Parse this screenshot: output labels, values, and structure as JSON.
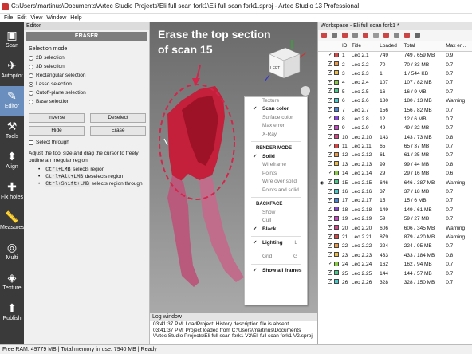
{
  "window": {
    "title": "C:\\Users\\martinus\\Documents\\Artec Studio Projects\\Eli full scan fork1\\Eli full scan fork1.sproj - Artec Studio 13 Professional"
  },
  "menu": [
    "File",
    "Edit",
    "View",
    "Window",
    "Help"
  ],
  "tools": [
    {
      "label": "Scan",
      "icon": "scan-icon"
    },
    {
      "label": "Autopilot",
      "icon": "autopilot-icon"
    },
    {
      "label": "Editor",
      "icon": "editor-icon"
    },
    {
      "label": "Tools",
      "icon": "tools-icon"
    },
    {
      "label": "Align",
      "icon": "align-icon"
    },
    {
      "label": "Fix holes",
      "icon": "fix-holes-icon"
    },
    {
      "label": "Measures",
      "icon": "measures-icon"
    },
    {
      "label": "Multi",
      "icon": "multi-icon"
    },
    {
      "label": "Texture",
      "icon": "texture-icon"
    },
    {
      "label": "Publish",
      "icon": "publish-icon"
    }
  ],
  "editor": {
    "header": "Editor",
    "tool_title": "ERASER",
    "selection_mode_label": "Selection mode",
    "modes": [
      "2D selection",
      "3D selection",
      "Rectangular selection",
      "Lasso selection",
      "Cutoff-plane selection",
      "Base selection"
    ],
    "selected_mode": "Lasso selection",
    "buttons": {
      "inverse": "Inverse",
      "deselect": "Deselect",
      "hide": "Hide",
      "erase": "Erase"
    },
    "select_through": "Select through",
    "help_text": "Adjust the tool size and drag the cursor to freely outline an irregular region.",
    "hints": [
      {
        "keys": "Ctrl+LMB",
        "text": " selects region"
      },
      {
        "keys": "Ctrl+Alt+LMB",
        "text": " deselects region"
      },
      {
        "keys": "Ctrl+Shift+LMB",
        "text": " selects region through"
      }
    ]
  },
  "viewport": {
    "annotation": "Erase the top section of scan 15",
    "cube_label": "LEFT",
    "accent_color": "#d4264b",
    "menu": [
      {
        "type": "item",
        "label": "Texture",
        "checked": false,
        "bold": false
      },
      {
        "type": "item",
        "label": "Scan color",
        "checked": true,
        "bold": true
      },
      {
        "type": "item",
        "label": "Surface color",
        "checked": false,
        "bold": false
      },
      {
        "type": "item",
        "label": "Max error",
        "checked": false,
        "bold": false
      },
      {
        "type": "item",
        "label": "X-Ray",
        "checked": false,
        "bold": false
      },
      {
        "type": "sep"
      },
      {
        "type": "header",
        "label": "RENDER MODE"
      },
      {
        "type": "item",
        "label": "Solid",
        "checked": true,
        "bold": true
      },
      {
        "type": "item",
        "label": "Wireframe",
        "checked": false,
        "bold": false
      },
      {
        "type": "item",
        "label": "Points",
        "checked": false,
        "bold": false
      },
      {
        "type": "item",
        "label": "Wire over solid",
        "checked": false,
        "bold": false
      },
      {
        "type": "item",
        "label": "Points and solid",
        "checked": false,
        "bold": false
      },
      {
        "type": "sep"
      },
      {
        "type": "header",
        "label": "BACKFACE"
      },
      {
        "type": "item",
        "label": "Show",
        "checked": false,
        "bold": false
      },
      {
        "type": "item",
        "label": "Cull",
        "checked": false,
        "bold": false
      },
      {
        "type": "item",
        "label": "Black",
        "checked": true,
        "bold": true
      },
      {
        "type": "sep"
      },
      {
        "type": "item",
        "label": "Lighting",
        "checked": true,
        "bold": true,
        "shortcut": "L"
      },
      {
        "type": "sep"
      },
      {
        "type": "item",
        "label": "Grid",
        "checked": false,
        "bold": false,
        "shortcut": "G"
      },
      {
        "type": "sep"
      },
      {
        "type": "item",
        "label": "Show all frames",
        "checked": true,
        "bold": true
      }
    ]
  },
  "log": {
    "header": "Log window",
    "lines": [
      "03:41:37 PM: LoadProject: History description file is absent.",
      "03:41:37 PM: Project loaded from C:\\Users\\martinus\\Documents",
      "\\Artec Studio Projects\\Eli full scan fork1 V2\\Eli full scan fork1 V2.sproj"
    ]
  },
  "workspace": {
    "header": "Workspace - Eli full scan fork1 *",
    "columns": [
      "ID",
      "Title",
      "Loaded",
      "Total",
      "Max er..."
    ],
    "rows": [
      {
        "id": "1",
        "title": "Leo 2.1",
        "loaded": "749",
        "total": "749 / 659 MB",
        "max": "0.9",
        "color": "#d44",
        "eye": false
      },
      {
        "id": "2",
        "title": "Leo 2.2",
        "loaded": "70",
        "total": "70 / 33 MB",
        "max": "0.7",
        "color": "#e94",
        "eye": false
      },
      {
        "id": "3",
        "title": "Leo 2.3",
        "loaded": "1",
        "total": "1 / 544 KB",
        "max": "0.7",
        "color": "#eb4",
        "eye": false
      },
      {
        "id": "4",
        "title": "Leo 2.4",
        "loaded": "107",
        "total": "107 / 82 MB",
        "max": "0.7",
        "color": "#8c4",
        "eye": false
      },
      {
        "id": "5",
        "title": "Leo 2.5",
        "loaded": "16",
        "total": "16 / 9 MB",
        "max": "0.7",
        "color": "#4c8",
        "eye": false
      },
      {
        "id": "6",
        "title": "Leo 2.6",
        "loaded": "180",
        "total": "180 / 13 MB",
        "max": "Warning",
        "color": "#4cc",
        "eye": false
      },
      {
        "id": "7",
        "title": "Leo 2.7",
        "loaded": "156",
        "total": "156 / 82 MB",
        "max": "0.7",
        "color": "#48d",
        "eye": false
      },
      {
        "id": "8",
        "title": "Leo 2.8",
        "loaded": "12",
        "total": "12 / 6 MB",
        "max": "0.7",
        "color": "#84d",
        "eye": false
      },
      {
        "id": "9",
        "title": "Leo 2.9",
        "loaded": "49",
        "total": "49 / 22 MB",
        "max": "0.7",
        "color": "#c4c",
        "eye": false
      },
      {
        "id": "10",
        "title": "Leo 2.10",
        "loaded": "143",
        "total": "143 / 73 MB",
        "max": "0.8",
        "color": "#d48",
        "eye": false
      },
      {
        "id": "11",
        "title": "Leo 2.11",
        "loaded": "65",
        "total": "65 / 37 MB",
        "max": "0.7",
        "color": "#d44",
        "eye": false
      },
      {
        "id": "12",
        "title": "Leo 2.12",
        "loaded": "61",
        "total": "61 / 25 MB",
        "max": "0.7",
        "color": "#e94",
        "eye": false
      },
      {
        "id": "13",
        "title": "Leo 2.13",
        "loaded": "99",
        "total": "99 / 44 MB",
        "max": "0.8",
        "color": "#eb4",
        "eye": false
      },
      {
        "id": "14",
        "title": "Leo 2.14",
        "loaded": "29",
        "total": "29 / 16 MB",
        "max": "0.6",
        "color": "#8c4",
        "eye": false
      },
      {
        "id": "15",
        "title": "Leo 2.15",
        "loaded": "646",
        "total": "646 / 387 MB",
        "max": "Warning",
        "color": "#4c8",
        "eye": true
      },
      {
        "id": "16",
        "title": "Leo 2.16",
        "loaded": "37",
        "total": "37 / 18 MB",
        "max": "0.7",
        "color": "#4cc",
        "eye": false
      },
      {
        "id": "17",
        "title": "Leo 2.17",
        "loaded": "15",
        "total": "15 / 6 MB",
        "max": "0.7",
        "color": "#48d",
        "eye": false
      },
      {
        "id": "18",
        "title": "Leo 2.18",
        "loaded": "149",
        "total": "149 / 61 MB",
        "max": "0.7",
        "color": "#84d",
        "eye": false
      },
      {
        "id": "19",
        "title": "Leo 2.19",
        "loaded": "59",
        "total": "59 / 27 MB",
        "max": "0.7",
        "color": "#c4c",
        "eye": false
      },
      {
        "id": "20",
        "title": "Leo 2.20",
        "loaded": "606",
        "total": "606 / 345 MB",
        "max": "Warning",
        "color": "#d48",
        "eye": false
      },
      {
        "id": "21",
        "title": "Leo 2.21",
        "loaded": "879",
        "total": "879 / 420 MB",
        "max": "Warning",
        "color": "#d44",
        "eye": false
      },
      {
        "id": "22",
        "title": "Leo 2.22",
        "loaded": "224",
        "total": "224 / 95 MB",
        "max": "0.7",
        "color": "#e94",
        "eye": false
      },
      {
        "id": "23",
        "title": "Leo 2.23",
        "loaded": "433",
        "total": "433 / 184 MB",
        "max": "0.8",
        "color": "#eb4",
        "eye": false
      },
      {
        "id": "24",
        "title": "Leo 2.24",
        "loaded": "162",
        "total": "162 / 94 MB",
        "max": "0.7",
        "color": "#8c4",
        "eye": false
      },
      {
        "id": "25",
        "title": "Leo 2.25",
        "loaded": "144",
        "total": "144 / 57 MB",
        "max": "0.7",
        "color": "#4c8",
        "eye": false
      },
      {
        "id": "26",
        "title": "Leo 2.26",
        "loaded": "328",
        "total": "328 / 150 MB",
        "max": "0.7",
        "color": "#4cc",
        "eye": false
      }
    ]
  },
  "status": "Free RAM: 49779 MB  |  Total memory in use: 7940 MB  |  Ready"
}
